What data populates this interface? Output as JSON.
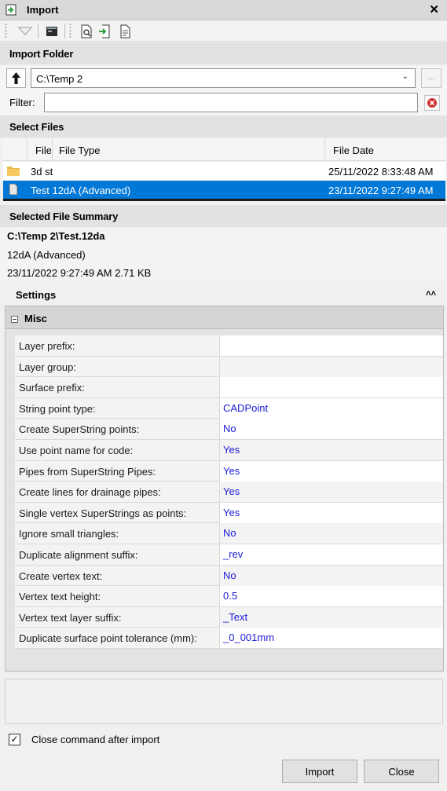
{
  "window": {
    "title": "Import",
    "close_glyph": "✕"
  },
  "toolbar": {
    "icons": [
      "filter-icon",
      "console-icon",
      "preview-icon",
      "import-icon",
      "document-icon"
    ]
  },
  "import_folder": {
    "heading": "Import Folder",
    "path": "C:\\Temp 2",
    "browse_label": "..."
  },
  "filter": {
    "label": "Filter:",
    "value": ""
  },
  "select_files": {
    "heading": "Select Files",
    "columns": {
      "file": "File",
      "file_type": "File Type",
      "file_date": "File Date"
    },
    "rows": [
      {
        "name": "3d st",
        "type": "",
        "date": "25/11/2022 8:33:48 AM",
        "kind": "folder"
      },
      {
        "name": "Test",
        "type": "12dA (Advanced)",
        "date": "23/11/2022 9:27:49 AM",
        "kind": "file",
        "selected": true
      }
    ]
  },
  "summary": {
    "heading": "Selected File Summary",
    "path": "C:\\Temp 2\\Test.12da",
    "type": "12dA (Advanced)",
    "info": "23/11/2022 9:27:49 AM 2.71 KB"
  },
  "settings": {
    "heading": "Settings",
    "group": "Misc",
    "properties": [
      {
        "name": "Layer prefix:",
        "value": "",
        "editable": true
      },
      {
        "name": "Layer group:",
        "value": "",
        "editable": false
      },
      {
        "name": "Surface prefix:",
        "value": "",
        "editable": true
      },
      {
        "name": "String point type:",
        "value": "CADPoint",
        "editable": true
      },
      {
        "name": "Create SuperString points:",
        "value": "No",
        "editable": true
      },
      {
        "name": "Use point name for code:",
        "value": "Yes",
        "editable": false
      },
      {
        "name": "Pipes from SuperString Pipes:",
        "value": "Yes",
        "editable": true
      },
      {
        "name": "Create lines for drainage pipes:",
        "value": "Yes",
        "editable": false
      },
      {
        "name": "Single vertex SuperStrings as points:",
        "value": "Yes",
        "editable": true
      },
      {
        "name": "Ignore small triangles:",
        "value": "No",
        "editable": false
      },
      {
        "name": "Duplicate alignment suffix:",
        "value": "_rev",
        "editable": true
      },
      {
        "name": "Create vertex text:",
        "value": "No",
        "editable": false
      },
      {
        "name": "Vertex text height:",
        "value": "0.5",
        "editable": true
      },
      {
        "name": "Vertex text layer suffix:",
        "value": "_Text",
        "editable": false
      },
      {
        "name": "Duplicate surface point tolerance (mm):",
        "value": "_0_001mm",
        "editable": true
      }
    ]
  },
  "close_after": {
    "label": "Close command after import",
    "checked": true
  },
  "buttons": {
    "import": "Import",
    "close": "Close"
  },
  "colors": {
    "selection": "#0078d7",
    "value_text": "#1a1ad6",
    "clear_icon": "#d32f2f"
  }
}
